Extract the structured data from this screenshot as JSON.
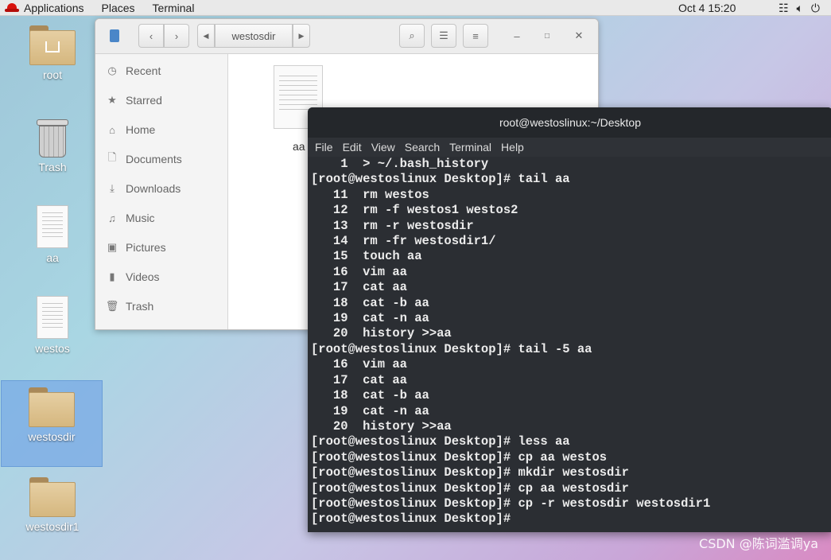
{
  "topbar": {
    "applications": "Applications",
    "places": "Places",
    "terminal": "Terminal",
    "clock": "Oct 4  15:20",
    "network_icon": "network-icon",
    "volume_icon": "volume-icon",
    "power_icon": "power-icon"
  },
  "desktop": {
    "icons": [
      {
        "label": "root",
        "type": "home-folder"
      },
      {
        "label": "Trash",
        "type": "trash"
      },
      {
        "label": "aa",
        "type": "text-file"
      },
      {
        "label": "westos",
        "type": "text-file"
      },
      {
        "label": "westosdir",
        "type": "folder",
        "selected": true
      },
      {
        "label": "westosdir1",
        "type": "folder"
      }
    ]
  },
  "file_manager": {
    "path_button": "westosdir",
    "sidebar": [
      {
        "label": "Recent",
        "icon": "clock-icon"
      },
      {
        "label": "Starred",
        "icon": "star-icon"
      },
      {
        "label": "Home",
        "icon": "home-icon"
      },
      {
        "label": "Documents",
        "icon": "document-icon"
      },
      {
        "label": "Downloads",
        "icon": "download-icon"
      },
      {
        "label": "Music",
        "icon": "music-icon"
      },
      {
        "label": "Pictures",
        "icon": "camera-icon"
      },
      {
        "label": "Videos",
        "icon": "video-icon"
      },
      {
        "label": "Trash",
        "icon": "trash-icon"
      }
    ],
    "file": {
      "label": "aa"
    }
  },
  "terminal": {
    "title": "root@westoslinux:~/Desktop",
    "menu": [
      "File",
      "Edit",
      "View",
      "Search",
      "Terminal",
      "Help"
    ],
    "lines": [
      "    1  > ~/.bash_history",
      "[root@westoslinux Desktop]# tail aa",
      "   11  rm westos",
      "   12  rm -f westos1 westos2",
      "   13  rm -r westosdir",
      "   14  rm -fr westosdir1/",
      "   15  touch aa",
      "   16  vim aa",
      "   17  cat aa",
      "   18  cat -b aa",
      "   19  cat -n aa",
      "   20  history >>aa",
      "[root@westoslinux Desktop]# tail -5 aa",
      "   16  vim aa",
      "   17  cat aa",
      "   18  cat -b aa",
      "   19  cat -n aa",
      "   20  history >>aa",
      "[root@westoslinux Desktop]# less aa",
      "[root@westoslinux Desktop]# cp aa westos",
      "[root@westoslinux Desktop]# mkdir westosdir",
      "[root@westoslinux Desktop]# cp aa westosdir",
      "[root@westoslinux Desktop]# cp -r westosdir westosdir1",
      "[root@westoslinux Desktop]# "
    ]
  },
  "watermark": "CSDN @陈词滥调ya"
}
